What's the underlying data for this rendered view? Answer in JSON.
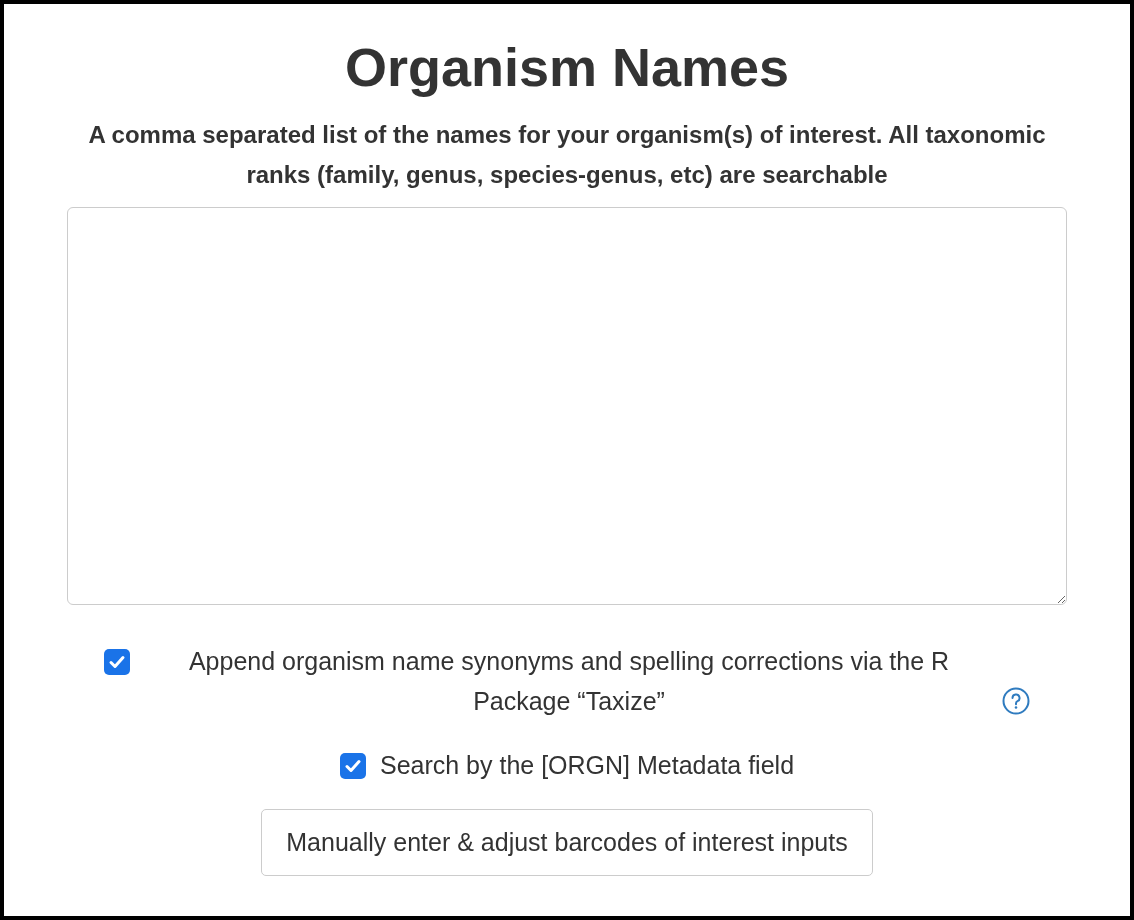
{
  "title": "Organism Names",
  "description": "A comma separated list of the names for your organism(s) of interest. All taxonomic ranks (family, genus, species-genus, etc) are searchable",
  "options": [
    {
      "label": "Append organism name synonyms and spelling corrections via the R Package “Taxize”",
      "checked": true,
      "help": true
    },
    {
      "label": "Search by the [ORGN] Metadata field",
      "checked": true,
      "help": false
    }
  ],
  "button": "Manually enter & adjust barcodes of interest inputs"
}
